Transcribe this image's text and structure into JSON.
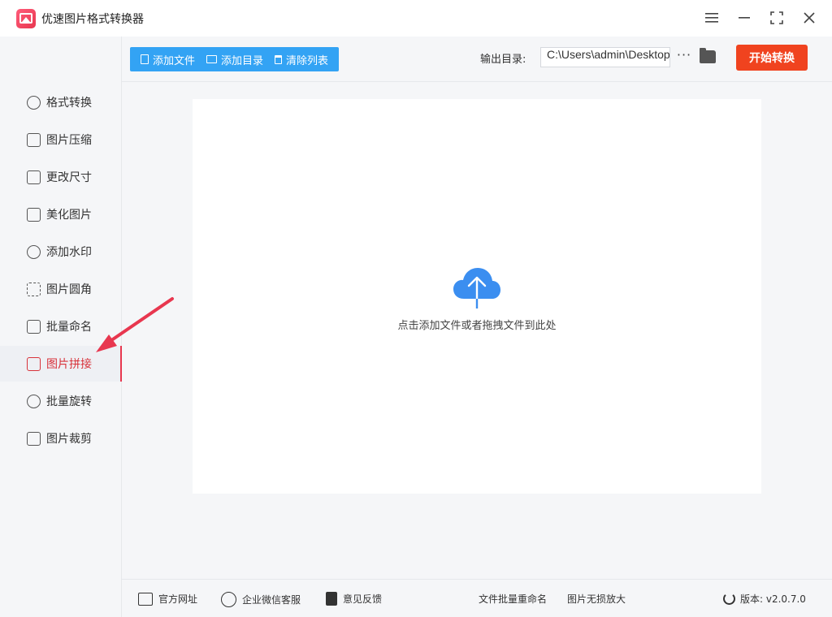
{
  "app": {
    "title": "优速图片格式转换器"
  },
  "window_controls": [
    "menu-icon",
    "minimize-icon",
    "maximize-icon",
    "close-icon"
  ],
  "sidebar": {
    "items": [
      {
        "label": "格式转换",
        "icon": "convert-icon"
      },
      {
        "label": "图片压缩",
        "icon": "compress-icon"
      },
      {
        "label": "更改尺寸",
        "icon": "resize-icon"
      },
      {
        "label": "美化图片",
        "icon": "beautify-icon"
      },
      {
        "label": "添加水印",
        "icon": "watermark-icon"
      },
      {
        "label": "图片圆角",
        "icon": "rounded-corner-icon"
      },
      {
        "label": "批量命名",
        "icon": "rename-icon"
      },
      {
        "label": "图片拼接",
        "icon": "stitch-icon",
        "active": true
      },
      {
        "label": "批量旋转",
        "icon": "rotate-icon"
      },
      {
        "label": "图片裁剪",
        "icon": "crop-icon"
      }
    ]
  },
  "toolbar": {
    "add_file": "添加文件",
    "add_folder": "添加目录",
    "clear_list": "清除列表",
    "output_label": "输出目录:",
    "output_path": "C:\\Users\\admin\\Desktop",
    "more": "···",
    "start": "开始转换"
  },
  "dropzone": {
    "text": "点击添加文件或者拖拽文件到此处",
    "icon": "cloud-upload-icon"
  },
  "footer": {
    "website": "官方网址",
    "wechat": "企业微信客服",
    "feedback": "意见反馈",
    "batch_rename": "文件批量重命名",
    "lossless_enlarge": "图片无损放大",
    "version": "版本: v2.0.7.0"
  },
  "colors": {
    "accent_blue": "#33a3f4",
    "start_orange": "#f0431f",
    "active_red": "#d8323a",
    "annotation_arrow": "#e8374f"
  }
}
